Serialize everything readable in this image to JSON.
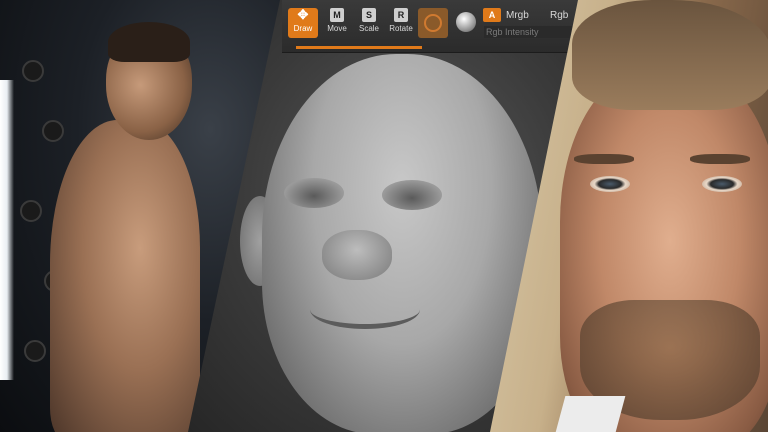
{
  "toolbar": {
    "tools": [
      {
        "label": "Draw",
        "glyph": "✥",
        "active": true
      },
      {
        "label": "Move",
        "glyph": "M",
        "active": false
      },
      {
        "label": "Scale",
        "glyph": "S",
        "active": false
      },
      {
        "label": "Rotate",
        "glyph": "R",
        "active": false
      }
    ],
    "rgb_toggle": "A",
    "mrgb_label": "Mrgb",
    "rgb_label": "Rgb",
    "rgb_intensity_label": "Rgb Intensity"
  },
  "colors": {
    "accent": "#e07a1a",
    "toolbar_bg": "#333333",
    "sculpt_clay": "#a8a8a8"
  },
  "icons": {
    "draw": "crosshair-move-icon",
    "material": "material-swatch-icon",
    "sphere": "sphere-icon"
  }
}
